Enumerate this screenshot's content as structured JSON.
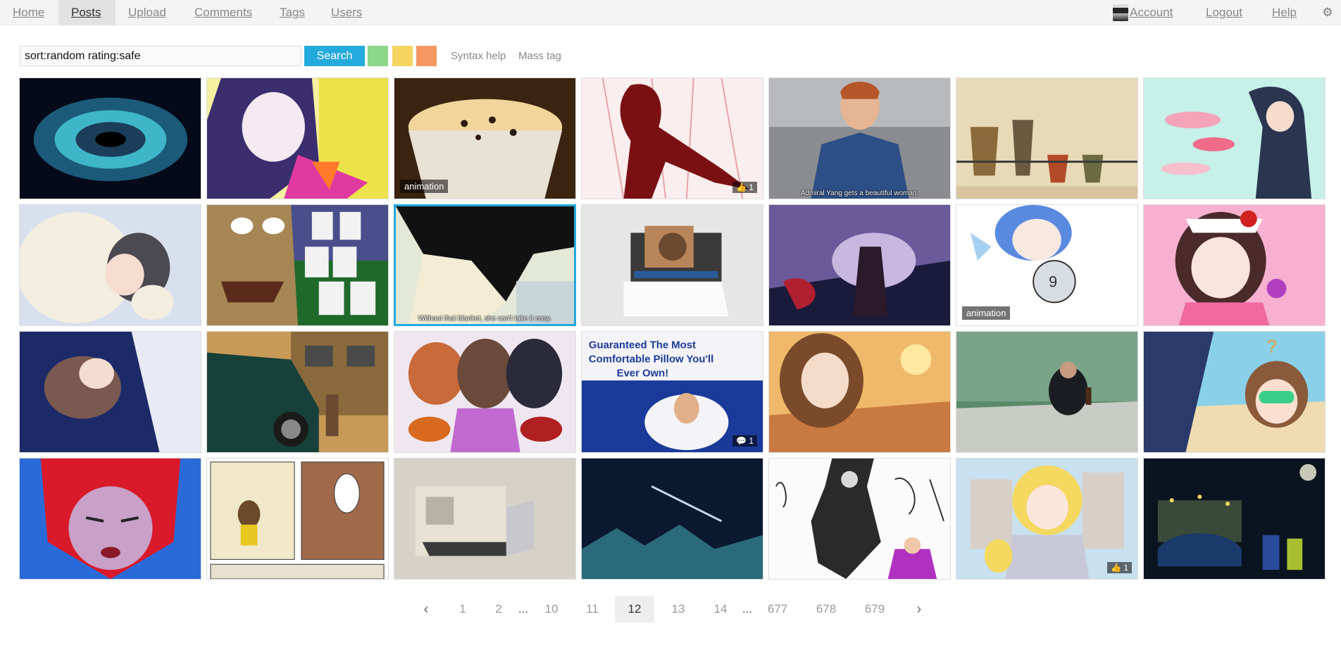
{
  "nav": {
    "home": "Home",
    "posts": "Posts",
    "upload": "Upload",
    "comments": "Comments",
    "tags": "Tags",
    "users": "Users",
    "account": "Account",
    "logout": "Logout",
    "help": "Help"
  },
  "search": {
    "value": "sort:random rating:safe",
    "button": "Search",
    "syntax_help": "Syntax help",
    "mass_tag": "Mass tag"
  },
  "colors": {
    "accent": "#24aadd",
    "safe": "#8cd78a",
    "sketchy": "#f5d560",
    "unsafe": "#f59760"
  },
  "posts": [
    {
      "title": "black hole galaxy"
    },
    {
      "title": "anime girl dark hair"
    },
    {
      "title": "cupcake",
      "badge": "animation"
    },
    {
      "title": "red silhouette figure",
      "score": "1"
    },
    {
      "title": "anime man blue shirt",
      "caption": "Admiral Yang gets a beautiful woman."
    },
    {
      "title": "medieval tapestry"
    },
    {
      "title": "anime girl petals"
    },
    {
      "title": "girl with polar bear"
    },
    {
      "title": "mahjong man"
    },
    {
      "title": "anime boy profile",
      "caption": "Without that blanket, she can't take it easy."
    },
    {
      "title": "computer with cooler"
    },
    {
      "title": "dark fantasy girl"
    },
    {
      "title": "chibi girl with fan",
      "badge": "animation"
    },
    {
      "title": "idol girl strawberries"
    },
    {
      "title": "girls in night sky"
    },
    {
      "title": "green car and man"
    },
    {
      "title": "three idol girls with guitars"
    },
    {
      "title": "pillow box ad",
      "comments": "1",
      "ad_line1": "Guaranteed The Most",
      "ad_line2": "Comfortable Pillow You'll",
      "ad_line3": "Ever Own!"
    },
    {
      "title": "girl at sunset station"
    },
    {
      "title": "man at table"
    },
    {
      "title": "beach girl with goggles"
    },
    {
      "title": "red haired character"
    },
    {
      "title": "comic page"
    },
    {
      "title": "laptop and retro computer"
    },
    {
      "title": "comet over mountains"
    },
    {
      "title": "dark figure comic"
    },
    {
      "title": "fantasy girls castle",
      "score": "1"
    },
    {
      "title": "car at night city"
    }
  ],
  "pager": {
    "pages": [
      "1",
      "2",
      "...",
      "10",
      "11",
      "12",
      "13",
      "14",
      "...",
      "677",
      "678",
      "679"
    ],
    "current": "12"
  }
}
